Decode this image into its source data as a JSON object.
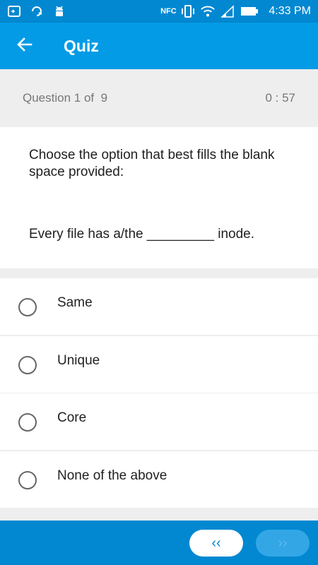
{
  "status_bar": {
    "time": "4:33 PM",
    "left_icons": [
      "screen-icon",
      "sync-icon",
      "android-icon"
    ],
    "right_icons": [
      "nfc-icon",
      "vibrate-icon",
      "wifi-icon",
      "signal-icon",
      "battery-icon"
    ],
    "nfc_text": "NFC"
  },
  "app_bar": {
    "title": "Quiz",
    "back_icon": "arrow-left-icon"
  },
  "question_header": {
    "counter": "Question 1 of  9",
    "timer": "0 : 57"
  },
  "question": {
    "text": "Choose the option that best fills the blank space provided:",
    "sentence": "Every file has a/the _________ inode."
  },
  "options": [
    {
      "label": "Same",
      "selected": false
    },
    {
      "label": "Unique",
      "selected": false
    },
    {
      "label": "Core",
      "selected": false
    },
    {
      "label": "None of the above",
      "selected": false
    }
  ],
  "navigation": {
    "prev_label": "‹‹",
    "next_label": "››"
  },
  "colors": {
    "primary": "#039be5",
    "primary_dark": "#0288d1",
    "background": "#eeeeee"
  }
}
